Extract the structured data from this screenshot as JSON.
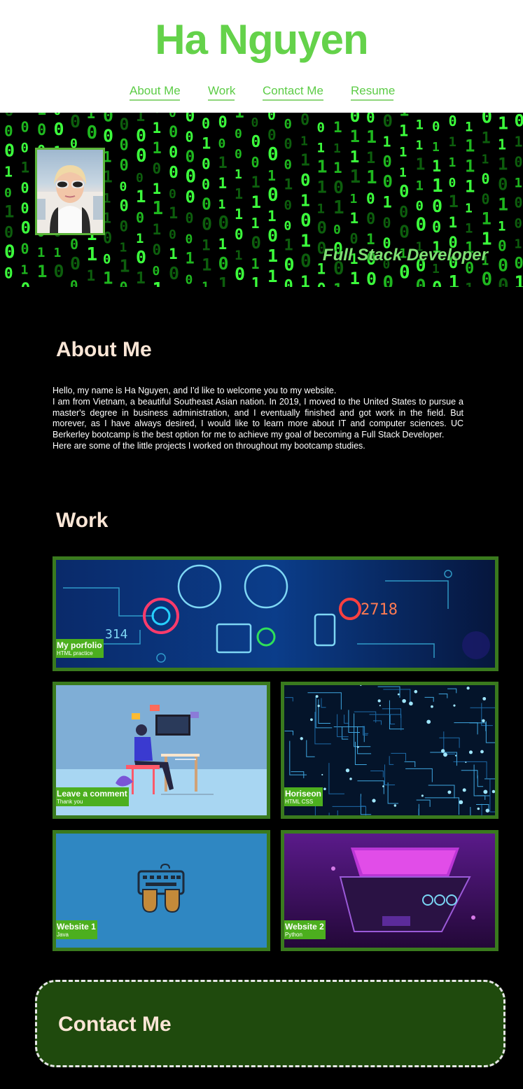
{
  "header": {
    "title": "Ha Nguyen",
    "nav": [
      {
        "label": "About Me"
      },
      {
        "label": "Work"
      },
      {
        "label": "Contact Me"
      },
      {
        "label": "Resume"
      }
    ]
  },
  "hero": {
    "tagline": "Full Stack Developer"
  },
  "about": {
    "heading": "About Me",
    "paragraphs": [
      "Hello, my name is Ha Nguyen, and I'd like to welcome you to my website.",
      "I am from Vietnam, a beautiful Southeast Asian nation. In 2019, I moved to the United States to pursue a master's degree in business administration, and I eventually finished and got work in the field. But morever, as I have always desired, I would like to learn more about IT and computer sciences. UC Berkerley bootcamp is the best option for me to achieve my goal of becoming a Full Stack Developer.",
      "Here are some of the little projects I worked on throughout my bootcamp studies."
    ]
  },
  "work": {
    "heading": "Work",
    "projects": [
      {
        "title": "My porfolio",
        "subtitle": "HTML practice"
      },
      {
        "title": "Leave a comment",
        "subtitle": "Thank you"
      },
      {
        "title": "Horiseon",
        "subtitle": "HTML CSS"
      },
      {
        "title": "Website 1",
        "subtitle": "Java"
      },
      {
        "title": "Website 2",
        "subtitle": "Python"
      }
    ]
  },
  "contact": {
    "heading": "Contact Me"
  },
  "colors": {
    "brand_green": "#64d24a",
    "card_border": "#3a7a1e",
    "caption_bg": "#4caf1e",
    "heading_text": "#fbe6d6",
    "contact_bg": "#1f4a0d"
  }
}
